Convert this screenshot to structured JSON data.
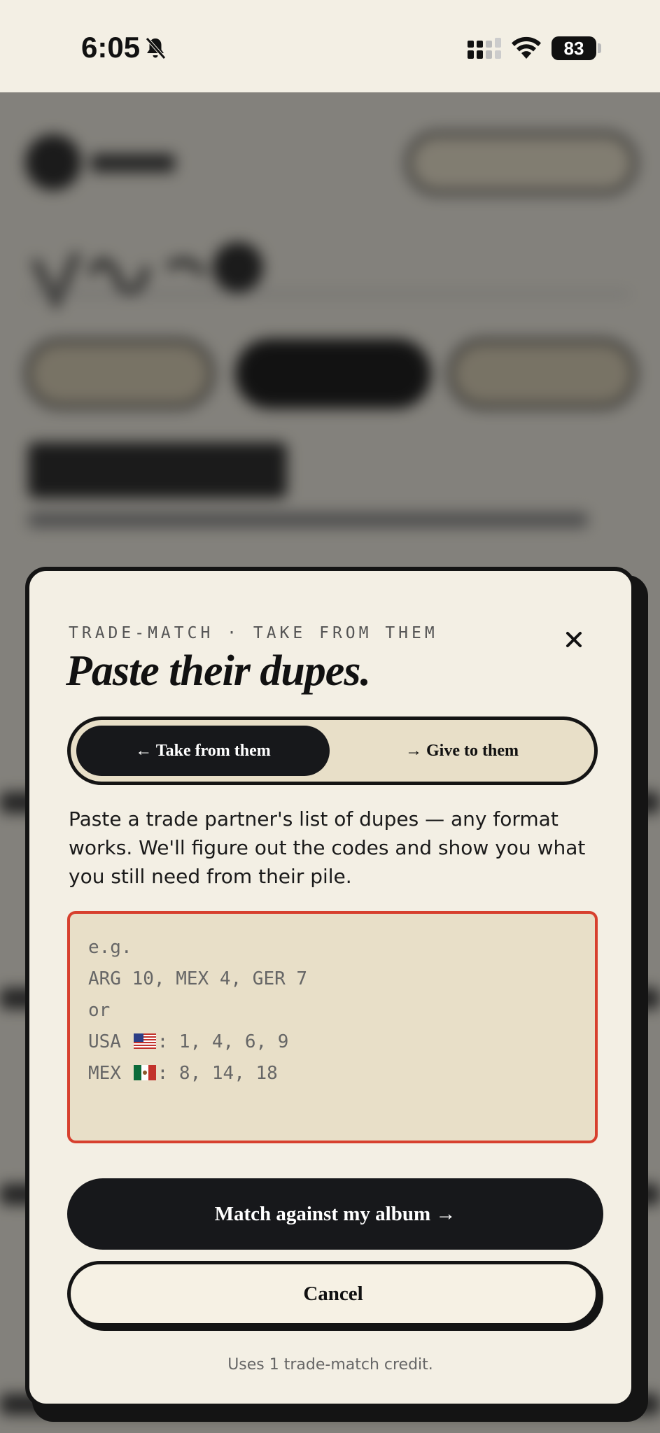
{
  "status_bar": {
    "time": "6:05",
    "battery": "83",
    "icons": [
      "bell-slash-icon",
      "cellular-signal-icon",
      "wifi-icon",
      "battery-icon"
    ]
  },
  "modal": {
    "eyebrow": "TRADE-MATCH · TAKE FROM THEM",
    "title": "Paste their dupes.",
    "close_icon": "close-icon",
    "tabs": [
      {
        "label": "← Take from them",
        "selected": true
      },
      {
        "label": "→ Give to them",
        "selected": false
      }
    ],
    "description": "Paste a trade partner's list of dupes — any format works. We'll figure out the codes and show you what you still need from their pile.",
    "input": {
      "value": "",
      "placeholder_lines": [
        "e.g.",
        "ARG 10, MEX 4, GER 7",
        "or",
        {
          "prefix": "USA",
          "flag": "us-flag-icon",
          "suffix": ": 1, 4, 6, 9"
        },
        {
          "prefix": "MEX",
          "flag": "mexico-flag-icon",
          "suffix": ": 8, 14, 18"
        }
      ]
    },
    "primary_button": "Match against my album →",
    "cancel_button": "Cancel",
    "footnote": "Uses 1 trade-match credit."
  },
  "colors": {
    "background": "#f3efe4",
    "ink": "#17181b",
    "input_fill": "#e8dfc8",
    "input_border": "#d7402e"
  }
}
